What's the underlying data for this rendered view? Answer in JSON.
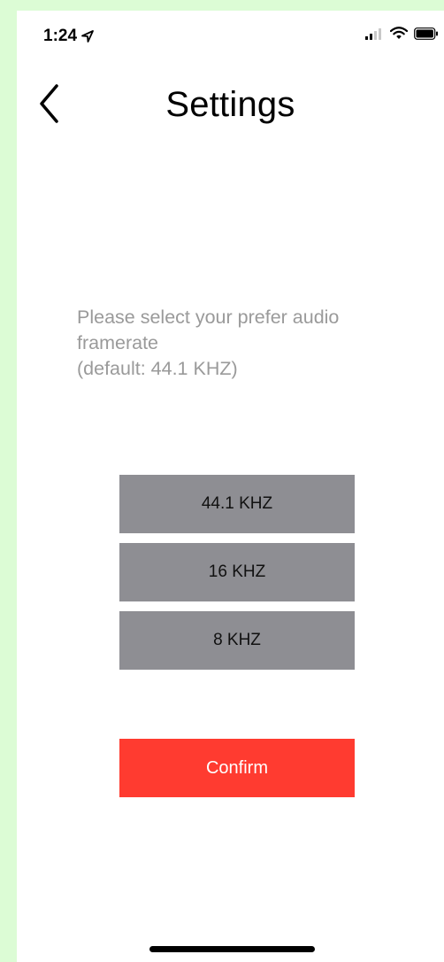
{
  "status_bar": {
    "time": "1:24",
    "icons": [
      "location-arrow-icon",
      "signal-icon",
      "wifi-icon",
      "battery-icon"
    ]
  },
  "nav": {
    "back_icon": "chevron-left-icon",
    "title": "Settings"
  },
  "prompt": {
    "line1": "Please select your prefer audio",
    "line2": "framerate",
    "line3": "(default: 44.1 KHZ)"
  },
  "options": [
    {
      "label": "44.1 KHZ"
    },
    {
      "label": "16 KHZ"
    },
    {
      "label": "8 KHZ"
    }
  ],
  "confirm_label": "Confirm",
  "colors": {
    "background": "#dcfcd5",
    "option_button": "#8e8e93",
    "confirm_button": "#ff3b30",
    "prompt_text": "#9a9a9a"
  }
}
